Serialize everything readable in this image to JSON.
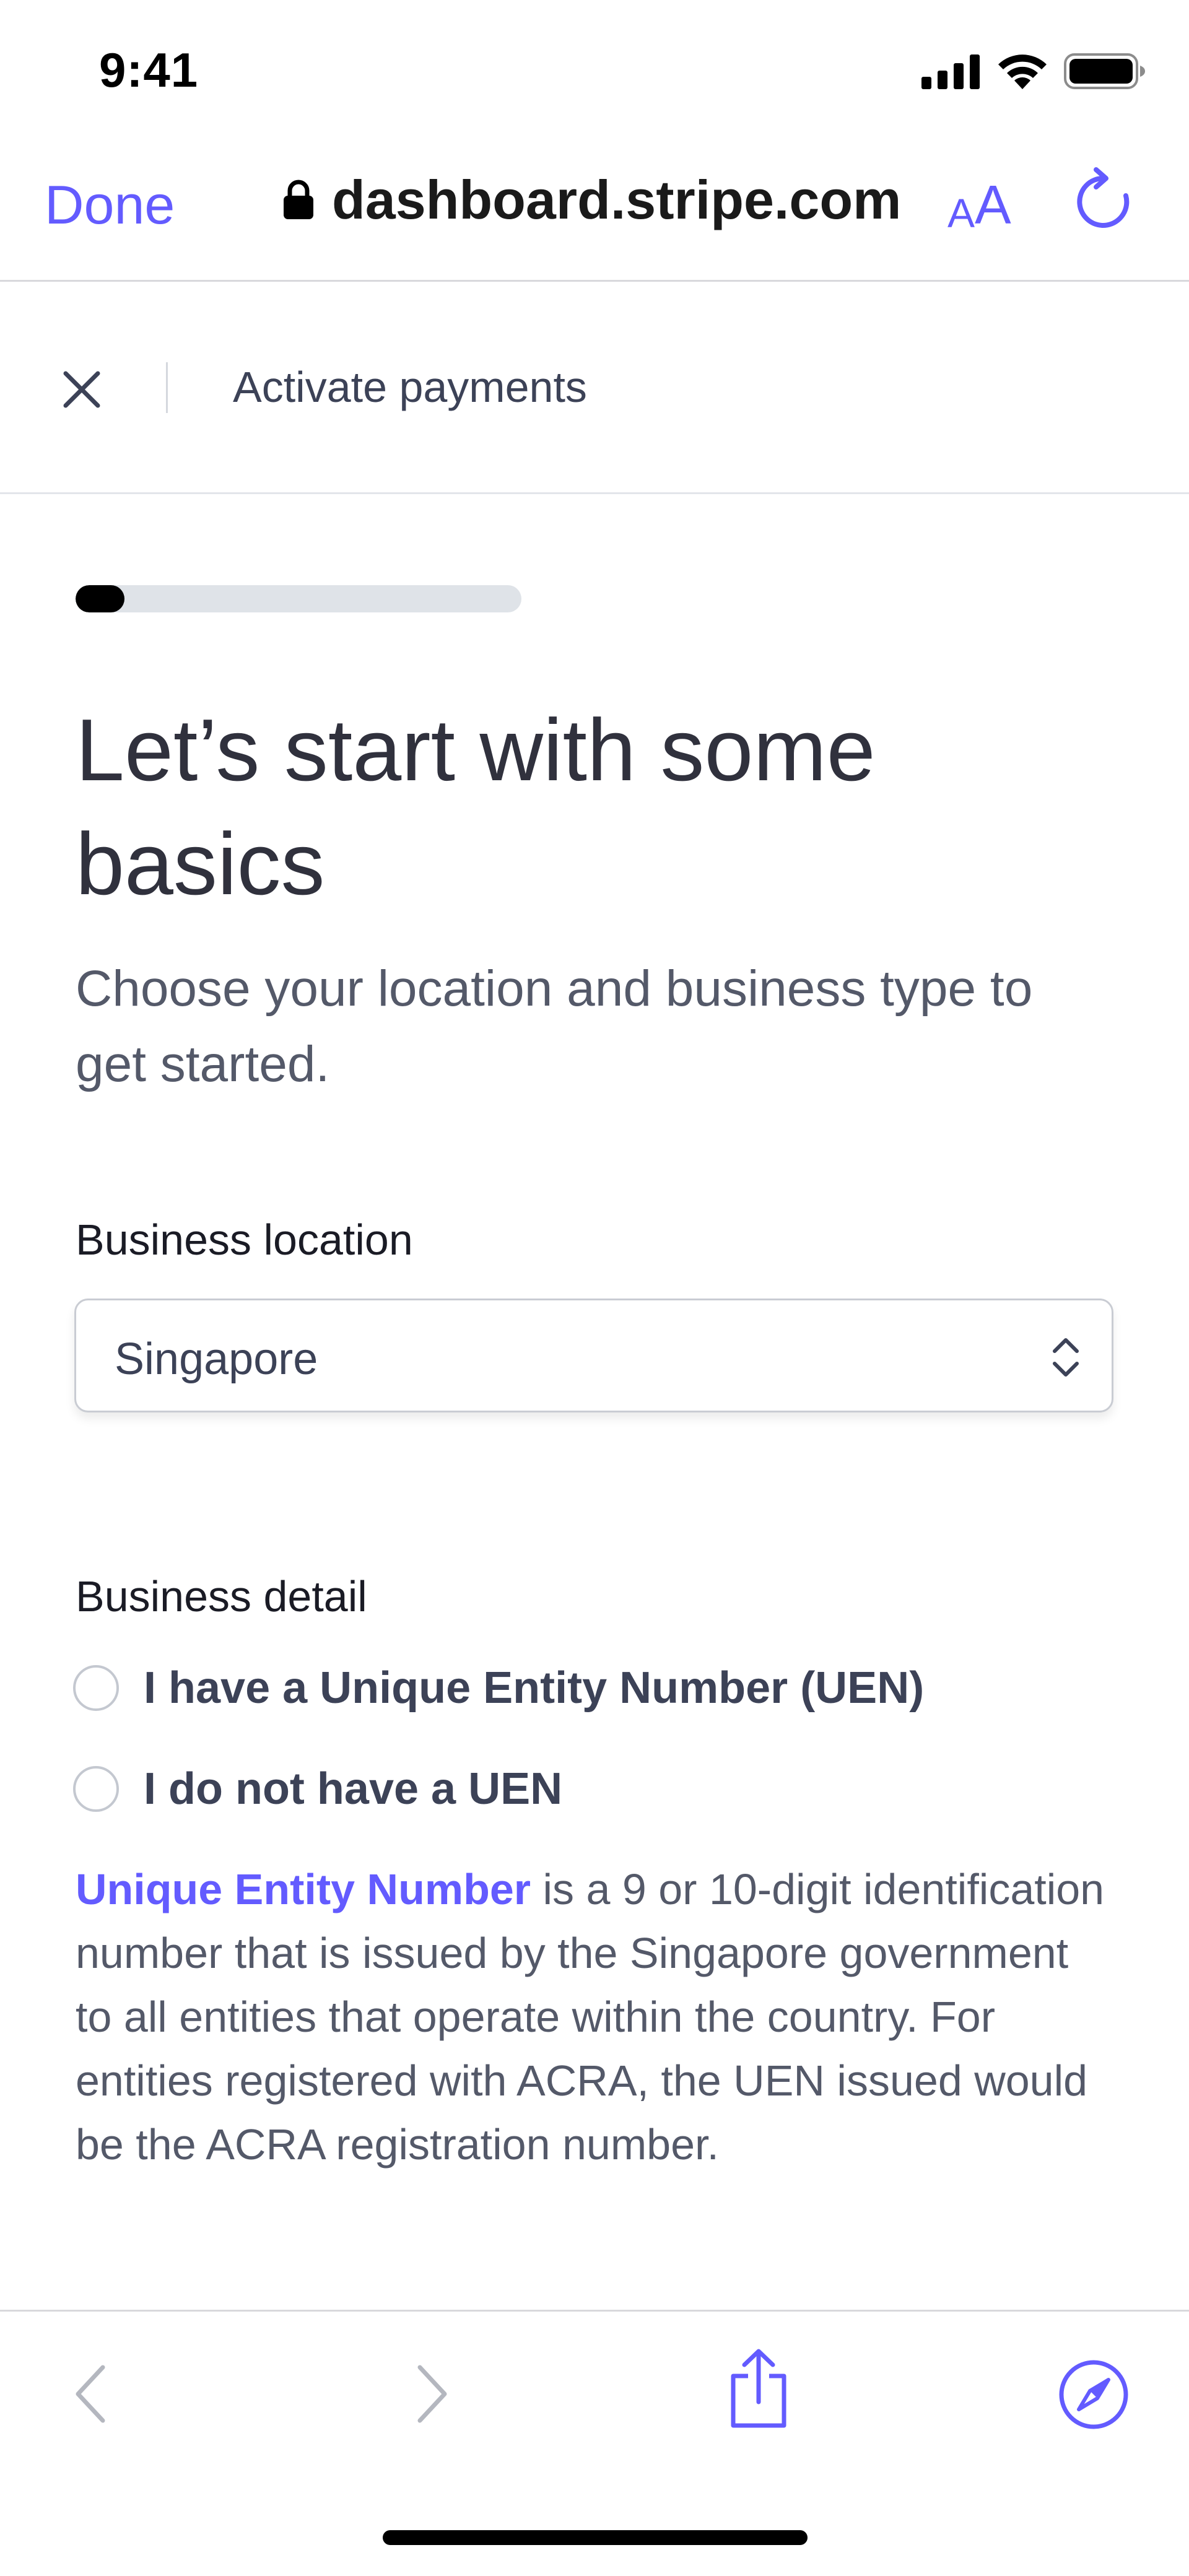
{
  "status_bar": {
    "time": "9:41"
  },
  "browser": {
    "done_label": "Done",
    "url": "dashboard.stripe.com",
    "text_size_small": "A",
    "text_size_big": "A",
    "accent_color": "#635bff"
  },
  "header": {
    "title": "Activate payments"
  },
  "progress": {
    "fraction": 0.11
  },
  "main": {
    "heading": "Let’s start with some basics",
    "subtitle": "Choose your location and business type to get started.",
    "location_label": "Business location",
    "location_value": "Singapore",
    "detail_label": "Business detail",
    "options": [
      {
        "label": "I have a Unique Entity Number (UEN)",
        "selected": false
      },
      {
        "label": "I do not have a UEN",
        "selected": false
      }
    ],
    "info_link": "Unique Entity Number",
    "info_text": " is a 9 or 10-digit identification number that is issued by the Singapore government to all entities that operate within the country. For entities registered with ACRA, the UEN issued would be the ACRA registration number."
  },
  "icons": {
    "lock": "lock-icon",
    "reload": "reload-icon",
    "close": "close-icon",
    "select_chevron": "chevron-up-down-icon",
    "back": "chevron-left-icon",
    "forward": "chevron-right-icon",
    "share": "share-icon",
    "compass": "compass-icon"
  }
}
